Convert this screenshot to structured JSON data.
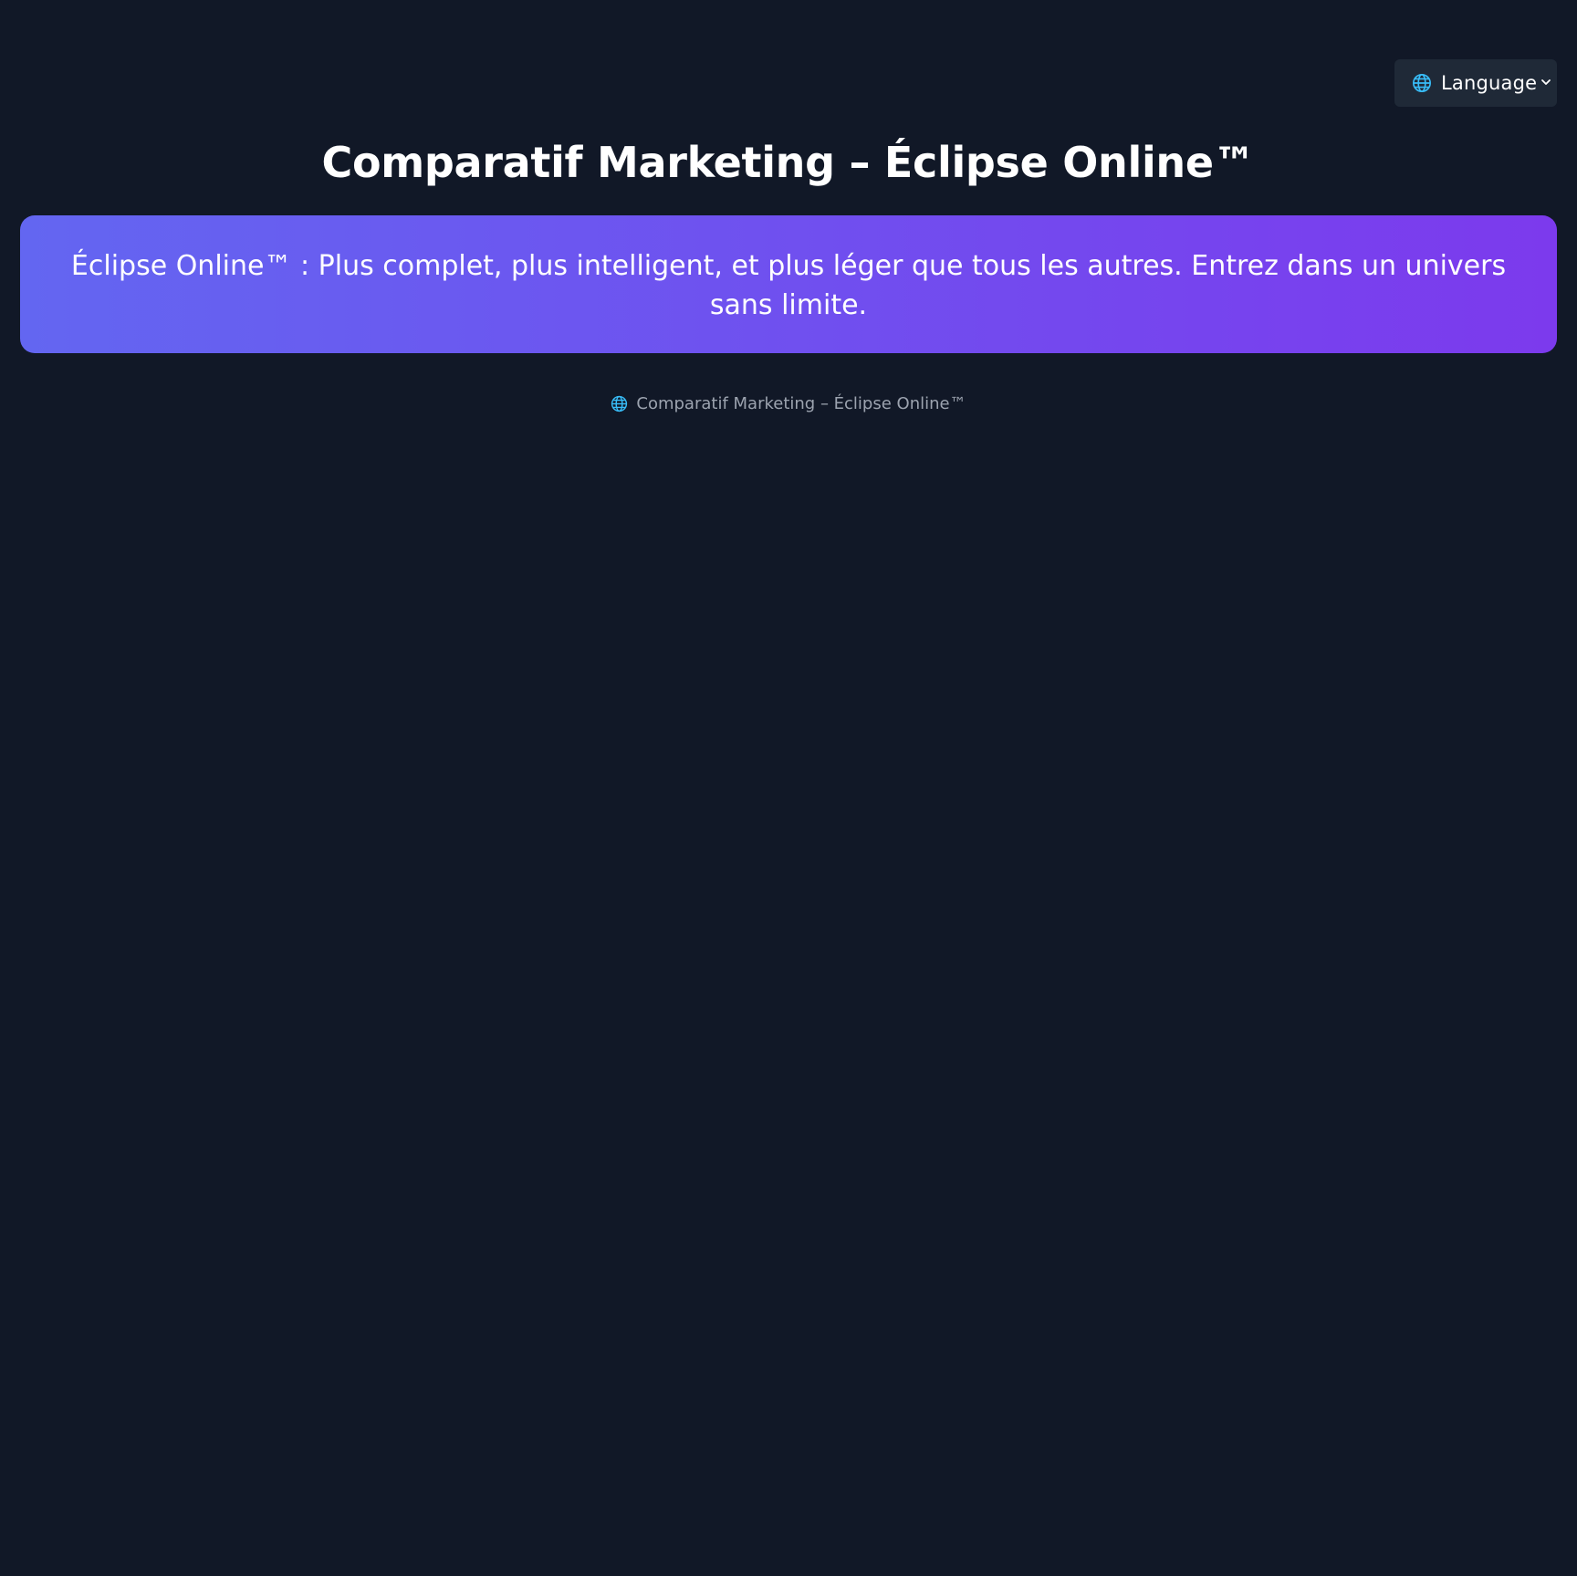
{
  "language_selector": {
    "icon": "globe-icon",
    "label": "Language",
    "chevron_icon": "chevron-down-icon"
  },
  "header": {
    "title": "Comparatif Marketing – Éclipse Online™"
  },
  "banner": {
    "text": "Éclipse Online™ : Plus complet, plus intelligent, et plus léger que tous les autres. Entrez dans un univers sans limite.",
    "gradient_start": "#6366f1",
    "gradient_end": "#7c3aed"
  },
  "footer": {
    "icon": "globe-icon",
    "text": "Comparatif Marketing – Éclipse Online™"
  },
  "colors": {
    "background": "#111827",
    "select_background": "#1f2937",
    "footer_text": "#9ca3af",
    "globe": "#38bdf8"
  }
}
